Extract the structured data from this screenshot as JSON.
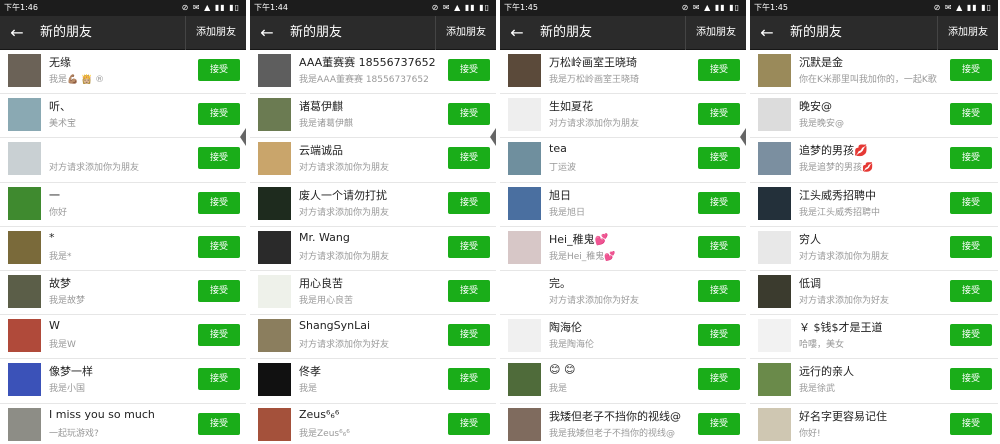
{
  "panels": [
    {
      "time": "下午1:46",
      "sys": "⊘ ✉ ▲ ▮▮ ▮▯",
      "title": "新的朋友",
      "add": "添加朋友",
      "items": [
        {
          "name": "无缘",
          "sub": "我是💪🏽 👸🏼 ®",
          "bg": "#6b6257"
        },
        {
          "name": "听、",
          "sub": "美术宝",
          "bg": "#8aa9b3"
        },
        {
          "name": "",
          "sub": "对方请求添加你为朋友",
          "bg": "#c9d0d3"
        },
        {
          "name": "一",
          "sub": "你好",
          "bg": "#3f8a2f"
        },
        {
          "name": "*",
          "sub": "我是*",
          "bg": "#7a6a3a"
        },
        {
          "name": "故梦",
          "sub": "我是故梦",
          "bg": "#5b5e48"
        },
        {
          "name": "W",
          "sub": "我是W",
          "bg": "#b04a3a"
        },
        {
          "name": "像梦一样",
          "sub": "我是小国",
          "bg": "#3b52b8"
        },
        {
          "name": "I miss you so much",
          "sub": "一起玩游戏?",
          "bg": "#8d8d86"
        }
      ]
    },
    {
      "time": "下午1:44",
      "sys": "⊘ ✉ ▲ ▮▮ ▮▯",
      "title": "新的朋友",
      "add": "添加朋友",
      "items": [
        {
          "name": "AAA董赛赛 18556737652",
          "sub": "我是AAA董赛赛 18556737652",
          "bg": "#5e5e5e"
        },
        {
          "name": "诸葛伊麒",
          "sub": "我是诸葛伊麒",
          "bg": "#6b7b52"
        },
        {
          "name": "云端诚品",
          "sub": "对方请求添加你为朋友",
          "bg": "#c9a56b"
        },
        {
          "name": "废人一个请勿打扰",
          "sub": "对方请求添加你为朋友",
          "bg": "#1e2b1e"
        },
        {
          "name": "Mr. Wang",
          "sub": "对方请求添加你为朋友",
          "bg": "#2a2a2a"
        },
        {
          "name": "用心良苦",
          "sub": "我是用心良苦",
          "bg": "#eef1ea"
        },
        {
          "name": "ShangSynLai",
          "sub": "对方请求添加你为好友",
          "bg": "#8b7e5e"
        },
        {
          "name": "佟孝",
          "sub": "我是",
          "bg": "#111111"
        },
        {
          "name": "Zeus⁶₆⁶",
          "sub": "我是Zeus⁶₆⁶",
          "bg": "#a4513b"
        }
      ]
    },
    {
      "time": "下午1:45",
      "sys": "⊘ ✉ ▲ ▮▮ ▮▯",
      "title": "新的朋友",
      "add": "添加朋友",
      "items": [
        {
          "name": "万松岭画室王晓琦",
          "sub": "我是万松岭画室王晓琦",
          "bg": "#5b4a3a"
        },
        {
          "name": "生如夏花",
          "sub": "对方请求添加你为朋友",
          "bg": "#eeeeee"
        },
        {
          "name": "tea",
          "sub": "丁运波",
          "bg": "#6f8f9e"
        },
        {
          "name": "旭日",
          "sub": "我是旭日",
          "bg": "#4a6fa0"
        },
        {
          "name": "Hei_稚鬼💕",
          "sub": "我是Hei_稚鬼💕",
          "bg": "#d7c7c7"
        },
        {
          "name": "完。",
          "sub": "对方请求添加你为好友",
          "bg": "#ffffff"
        },
        {
          "name": "陶海伦",
          "sub": "我是陶海伦",
          "bg": "#f0f0f0"
        },
        {
          "name": "😊 😊",
          "sub": "我是",
          "bg": "#4f6b3a"
        },
        {
          "name": "我矮但老子不挡你的视线@",
          "sub": "我是我矮但老子不挡你的视线@",
          "bg": "#7f6b5e"
        }
      ]
    },
    {
      "time": "下午1:45",
      "sys": "⊘ ✉ ▲ ▮▮ ▮▯",
      "title": "新的朋友",
      "add": "添加朋友",
      "items": [
        {
          "name": "沉默是金",
          "sub": "你在K米那里叫我加你的，一起K歌",
          "bg": "#9a8a5a"
        },
        {
          "name": "晚安@",
          "sub": "我是晚安@",
          "bg": "#dcdcdc"
        },
        {
          "name": "追梦的男孩💋",
          "sub": "我是追梦的男孩💋",
          "bg": "#7b8fa0"
        },
        {
          "name": "江头威秀招聘中",
          "sub": "我是江头威秀招聘中",
          "bg": "#23303a"
        },
        {
          "name": "穷人",
          "sub": "对方请求添加你为朋友",
          "bg": "#e8e8e8"
        },
        {
          "name": "低调",
          "sub": "对方请求添加你为好友",
          "bg": "#3b3b2e"
        },
        {
          "name": "￥ $钱$才是王道",
          "sub": "哈嘍，美女",
          "bg": "#f2f2f2"
        },
        {
          "name": "远行的亲人",
          "sub": "我是徐武",
          "bg": "#6a8a4a"
        },
        {
          "name": "好名字更容易记住",
          "sub": "你好!",
          "bg": "#cfc7b2"
        }
      ]
    }
  ],
  "accept_label": "接受"
}
